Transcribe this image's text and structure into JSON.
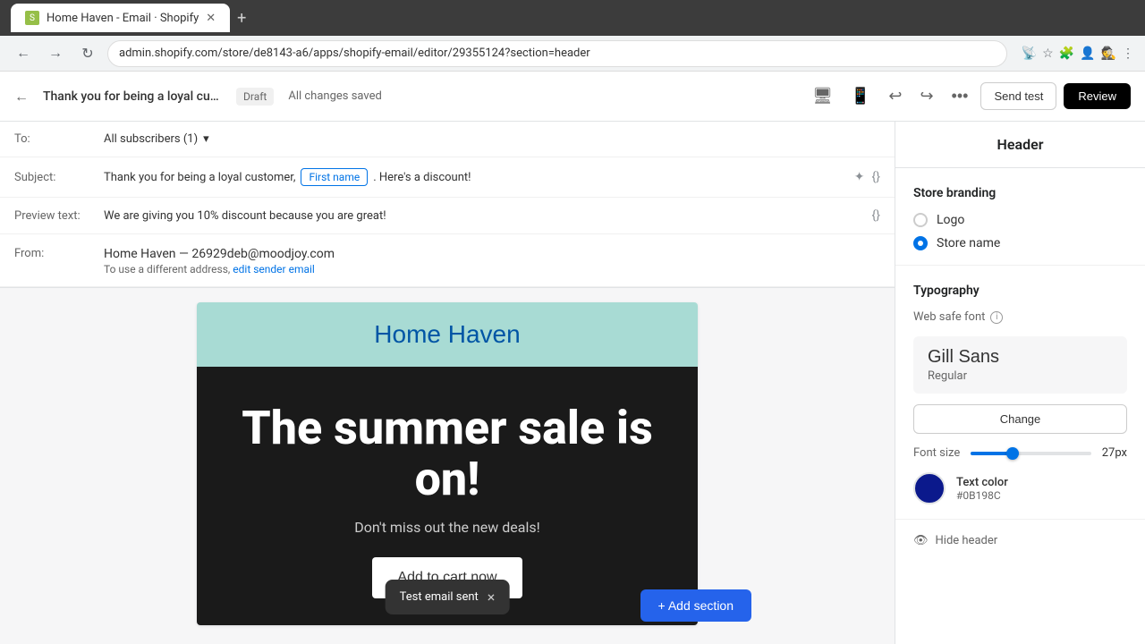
{
  "browser": {
    "tab_title": "Home Haven - Email · Shopify",
    "address": "admin.shopify.com/store/de8143-a6/apps/shopify-email/editor/29355124?section=header",
    "new_tab_icon": "+"
  },
  "header": {
    "email_title": "Thank you for being a loyal custome...",
    "draft_label": "Draft",
    "saved_label": "All changes saved",
    "send_test_label": "Send test",
    "review_label": "Review"
  },
  "email_fields": {
    "to_label": "To:",
    "to_value": "All subscribers (1)",
    "subject_label": "Subject:",
    "subject_prefix": "Thank you for being a loyal customer,",
    "subject_pill": "First name",
    "subject_suffix": ". Here's a discount!",
    "preview_label": "Preview text:",
    "preview_value": "We are giving you 10% discount because you are great!",
    "from_label": "From:",
    "from_value": "Home Haven — 26929deb@moodjoy.com",
    "from_sub": "To use a different address,",
    "edit_sender_link": "edit sender email"
  },
  "email_preview": {
    "store_name": "Home Haven",
    "headline": "The summer sale is on!",
    "subtext": "Don't miss out the new deals!",
    "cta_label": "Add to cart now",
    "header_bg": "#a8dbd4",
    "content_bg": "#1a1a1a",
    "store_name_color": "#0055a5"
  },
  "toast": {
    "message": "Test email sent",
    "close_icon": "×"
  },
  "add_section": {
    "label": "+ Add section"
  },
  "sidebar": {
    "title": "Header",
    "store_branding": {
      "title": "Store branding",
      "logo_label": "Logo",
      "store_name_label": "Store name",
      "selected": "store_name"
    },
    "typography": {
      "title": "Typography",
      "web_safe_label": "Web safe font",
      "font_name": "Gill Sans",
      "font_style": "Regular",
      "change_label": "Change",
      "font_size_label": "Font size",
      "font_size_value": "27px",
      "font_size_percent": 35,
      "text_color_label": "Text color",
      "text_color_hex": "#0B198C",
      "text_color_value": "#0B198C"
    },
    "hide_header": {
      "label": "Hide header"
    }
  }
}
